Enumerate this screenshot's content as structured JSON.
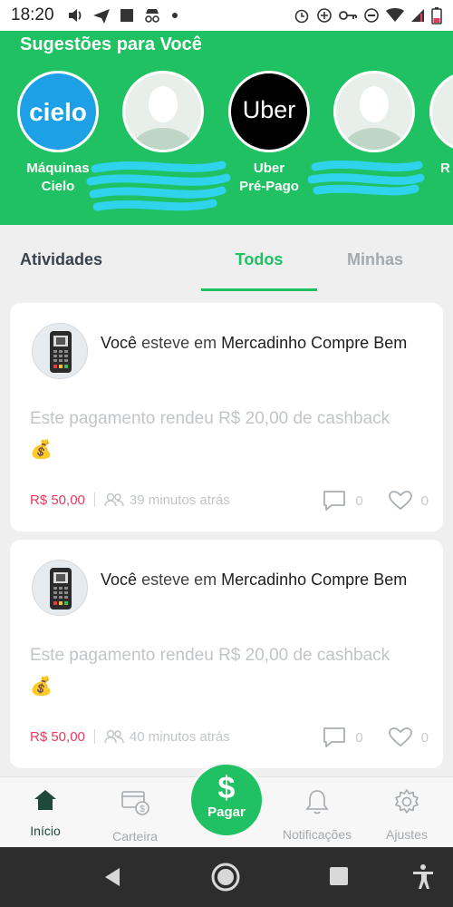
{
  "status": {
    "time": "18:20"
  },
  "suggestions": {
    "title": "Sugestões para Você",
    "items": [
      {
        "label": "Máquinas\nCielo",
        "logo_text": "cielo",
        "icon": "cielo-logo"
      },
      {
        "label": "",
        "icon": "person-avatar"
      },
      {
        "label": "Uber\nPré-Pago",
        "logo_text": "Uber",
        "icon": "uber-logo"
      },
      {
        "label": "",
        "icon": "person-avatar"
      },
      {
        "label": "R",
        "icon": "partial-avatar"
      }
    ]
  },
  "tabs": {
    "title": "Atividades",
    "all": "Todos",
    "mine": "Minhas",
    "selected": "Todos"
  },
  "feed": [
    {
      "actor": "Você",
      "verb": "esteve em",
      "place": "Mercadinho Compre Bem",
      "message": "Este pagamento rendeu R$ 20,00 de cashback",
      "emoji": "💰",
      "amount": "R$ 50,00",
      "time": "39 minutos atrás",
      "comments": "0",
      "likes": "0"
    },
    {
      "actor": "Você",
      "verb": "esteve em",
      "place": "Mercadinho Compre Bem",
      "message": "Este pagamento rendeu R$ 20,00 de cashback",
      "emoji": "💰",
      "amount": "R$ 50,00",
      "time": "40 minutos atrás",
      "comments": "0",
      "likes": "0"
    }
  ],
  "bottom_nav": {
    "home": "Início",
    "wallet": "Carteira",
    "pay_symbol": "$",
    "pay": "Pagar",
    "notifications": "Notificações",
    "settings": "Ajustes"
  },
  "colors": {
    "brand_green": "#1fc162",
    "amount_red": "#e53b5e",
    "home_active": "#1f4a3b"
  }
}
